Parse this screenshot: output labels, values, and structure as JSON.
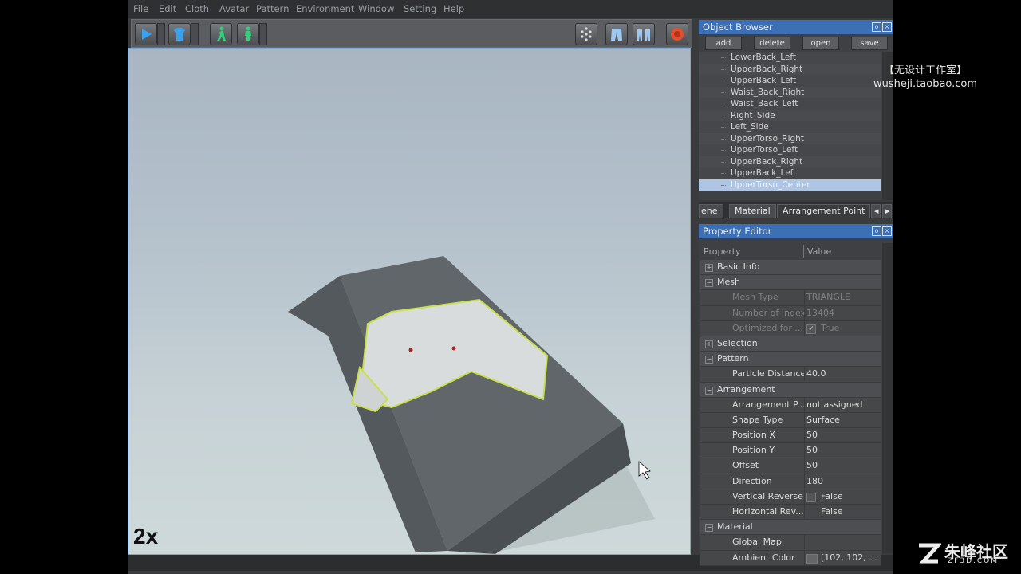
{
  "menu": [
    "File",
    "Edit",
    "Cloth",
    "Avatar",
    "Pattern",
    "Environment",
    "Window",
    "Setting",
    "Help"
  ],
  "viewport": {
    "speed_label": "2x"
  },
  "object_browser": {
    "title": "Object Browser",
    "actions": [
      "add",
      "delete",
      "open",
      "save"
    ],
    "items": [
      "LowerBack_Left",
      "UpperBack_Right",
      "UpperBack_Left",
      "Waist_Back_Right",
      "Waist_Back_Left",
      "Right_Side",
      "Left_Side",
      "UpperTorso_Right",
      "UpperTorso_Left",
      "UpperBack_Right",
      "UpperBack_Left",
      "UpperTorso_Center"
    ],
    "selected_index": 11
  },
  "tabs": [
    "ene",
    "Material",
    "Arrangement Point"
  ],
  "property_editor": {
    "title": "Property Editor",
    "col_property": "Property",
    "col_value": "Value",
    "rows": [
      {
        "type": "group",
        "expander": "+",
        "name": "Basic Info",
        "value": ""
      },
      {
        "type": "group",
        "expander": "−",
        "name": "Mesh",
        "value": ""
      },
      {
        "type": "prop",
        "name": "Mesh Type",
        "value": "TRIANGLE",
        "disabled": true
      },
      {
        "type": "prop",
        "name": "Number of Index",
        "value": "13404",
        "disabled": true
      },
      {
        "type": "check",
        "name": "Optimized for ...",
        "value": "True",
        "disabled": true,
        "checked": true
      },
      {
        "type": "group",
        "expander": "+",
        "name": "Selection",
        "value": ""
      },
      {
        "type": "group",
        "expander": "−",
        "name": "Pattern",
        "value": ""
      },
      {
        "type": "prop",
        "name": "Particle Distance",
        "value": "40.0"
      },
      {
        "type": "group",
        "expander": "−",
        "name": "Arrangement",
        "value": ""
      },
      {
        "type": "prop",
        "name": "Arrangement P...",
        "value": "not assigned"
      },
      {
        "type": "prop",
        "name": "Shape Type",
        "value": "Surface"
      },
      {
        "type": "prop",
        "name": "Position X",
        "value": "50"
      },
      {
        "type": "prop",
        "name": "Position Y",
        "value": "50"
      },
      {
        "type": "prop",
        "name": "Offset",
        "value": "50"
      },
      {
        "type": "prop",
        "name": "Direction",
        "value": "180"
      },
      {
        "type": "check",
        "name": "Vertical Reverse",
        "value": "False",
        "checked": false
      },
      {
        "type": "check",
        "name": "Horizontal Rev...",
        "value": "False",
        "checked": false,
        "nobox": true
      },
      {
        "type": "group",
        "expander": "−",
        "name": "Material",
        "value": ""
      },
      {
        "type": "prop",
        "name": "Global Map",
        "value": ""
      },
      {
        "type": "color",
        "name": "Ambient Color",
        "value": "[102, 102, ..."
      }
    ]
  },
  "watermark": {
    "line1": "【无设计工作室】",
    "line2": "wusheji.taobao.com"
  },
  "logo": {
    "name": "朱峰社区",
    "url": "ZF3D.COM"
  }
}
